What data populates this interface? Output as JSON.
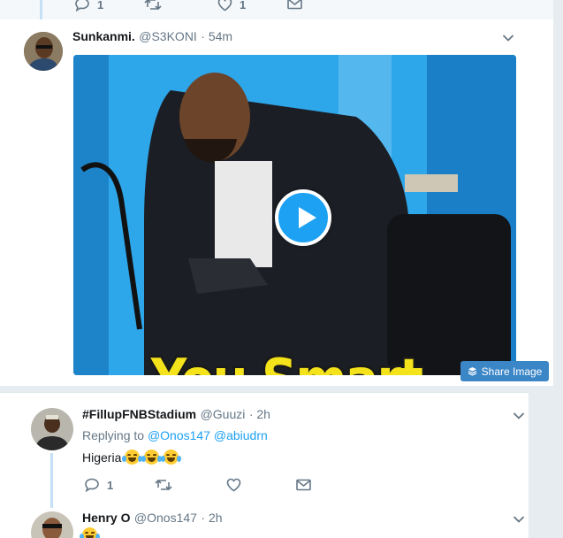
{
  "colors": {
    "link": "#1da1f2",
    "muted": "#657786",
    "thread": "#c4dff6"
  },
  "prev_tweet": {
    "reply_count": "1",
    "like_count": "1"
  },
  "tweet1": {
    "name": "Sunkanmi.",
    "handle": "@S3KONI",
    "time": "· 54m",
    "media": {
      "type": "gif-video",
      "caption": "You Smart."
    },
    "share_label": "Share Image"
  },
  "tweet2": {
    "name": "#FillupFNBStadium",
    "handle": "@Guuzi",
    "time": "· 2h",
    "replying_prefix": "Replying to",
    "replying_to": [
      "@Onos147",
      "@abiudrn"
    ],
    "text": "Higeria",
    "reply_count": "1"
  },
  "tweet3": {
    "name": "Henry O",
    "handle": "@Onos147",
    "time": "· 2h"
  }
}
